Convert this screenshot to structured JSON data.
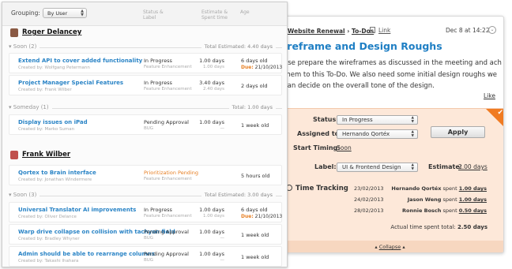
{
  "list": {
    "grouping_label": "Grouping:",
    "grouping_value": "By User",
    "columns": {
      "status": [
        "Status &",
        "Label"
      ],
      "estimate": [
        "Estimate &",
        "Spent time"
      ],
      "age": "Age"
    },
    "users": [
      {
        "name": "Roger Delancey",
        "avatar_color": "#8a5a44",
        "groups": [
          {
            "name": "Soon (2)",
            "total": "Total Estimated: 4.40 days",
            "tasks": [
              {
                "title": "Extend API to cover added functionality",
                "created_by": "Created by: Wolfgang Petermann",
                "status": "In Progress",
                "label": "Feature Enhancement",
                "estimate": "1.00 days",
                "spent": "1.00 days",
                "age": "6 days old",
                "due_label": "Due:",
                "due_date": "21/10/2013"
              },
              {
                "title": "Project Manager Special Features",
                "created_by": "Created by: Frank Wilber",
                "status": "In Progress",
                "label": "Feature Enhancement",
                "estimate": "3.40 days",
                "spent": "2.40 days",
                "age": "2 days old"
              }
            ]
          },
          {
            "name": "Someday (1)",
            "total": "Total: 1.00 days",
            "tasks": [
              {
                "title": "Display issues on iPad",
                "created_by": "Created by: Marko Suman",
                "status": "Pending Approval",
                "label": "BUG",
                "estimate": "1.00 days",
                "spent": "—",
                "age": "1 week old"
              }
            ]
          }
        ]
      },
      {
        "name": "Frank Wilber",
        "avatar_color": "#c0504d",
        "groups": [
          {
            "name": "",
            "total": "",
            "tasks": [
              {
                "title": "Qortex to Brain interface",
                "created_by": "Created by: Jonathan Windermere",
                "status": "Prioritization Pending",
                "label": "Feature Enhancement",
                "estimate": "",
                "spent": "",
                "age": "5 hours old",
                "status_orange": true
              }
            ]
          },
          {
            "name": "Soon (3)",
            "total": "Total Estimated: 3.00 days",
            "tasks": [
              {
                "title": "Universal Translator AI improvements",
                "created_by": "Created by: Oliver Delance",
                "status": "In Progress",
                "label": "Feature Enhancement",
                "estimate": "1.00 days",
                "spent": "1.00 days",
                "age": "6 days old",
                "due_label": "Due:",
                "due_date": "21/10/2013"
              },
              {
                "title": "Warp drive collapse on collision with tachyon field",
                "created_by": "Created by: Bradley Whyner",
                "status": "Pending Approval",
                "label": "BUG",
                "estimate": "1.00 days",
                "spent": "—",
                "age": "1 week old"
              },
              {
                "title": "Admin should be able to rearrange columns",
                "created_by": "Created by: Takashi Ihahara",
                "status": "Pending Approval",
                "label": "BUG",
                "estimate": "1.00 days",
                "spent": "—",
                "age": "1 week old"
              }
            ]
          }
        ]
      }
    ]
  },
  "detail": {
    "breadcrumb_project": "Website Renewal",
    "breadcrumb_sep": " › ",
    "breadcrumb_section": "To-Dos",
    "link_label": "Link",
    "date": "Dec 8 at 14:22",
    "title": "ireframe and Design Roughs",
    "description": "ase prepare the wireframes as discussed in the meeting and ach them to this To-Do. We also need some initial design roughs we can decide on the overall tone of the design.",
    "like_label": "Like",
    "status_label": "Status:",
    "status_value": "In Progress",
    "assigned_label": "Assigned to:",
    "assigned_value": "Hernando Qortéx",
    "apply_label": "Apply",
    "start_label": "Start Timing:",
    "start_value": "Soon",
    "label_label": "Label:",
    "label_value": "UI & Frontend Design",
    "estimate_label": "Estimate:",
    "estimate_value": "2.00 days",
    "time_tracking_label": "Time Tracking",
    "entries": [
      {
        "date": "23/02/2013",
        "who": "Hernando Qortéx",
        "spent_word": "spent",
        "amount": "1.00 days"
      },
      {
        "date": "24/02/2013",
        "who": "Jason Weng",
        "spent_word": "spent",
        "amount": "1.00 days"
      },
      {
        "date": "28/02/2013",
        "who": "Ronnie Bosch",
        "spent_word": "spent",
        "amount": "0.50 days"
      }
    ],
    "actual_label": "Actual time spent total:",
    "actual_value": "2.50 days",
    "collapse_label": "Collapse",
    "accent_color": "#f07b22",
    "link_color": "#1f7fc4"
  }
}
